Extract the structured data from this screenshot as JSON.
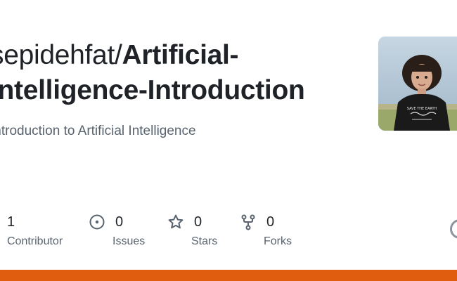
{
  "repo": {
    "owner": "sepidehfat/",
    "name_line1": "Artificial-",
    "name_line2": "Intelligence-Introduction",
    "description": "Introduction to Artificial Intelligence"
  },
  "avatar": {
    "shirt_text": "SAVE THE EARTH"
  },
  "stats": [
    {
      "icon": "people-icon",
      "value": "1",
      "label": "Contributor"
    },
    {
      "icon": "issue-icon",
      "value": "0",
      "label": "Issues"
    },
    {
      "icon": "star-icon",
      "value": "0",
      "label": "Stars"
    },
    {
      "icon": "fork-icon",
      "value": "0",
      "label": "Forks"
    }
  ],
  "colors": {
    "accent_bar": "#e05d0f",
    "text": "#1f2328",
    "muted": "#59636e"
  }
}
